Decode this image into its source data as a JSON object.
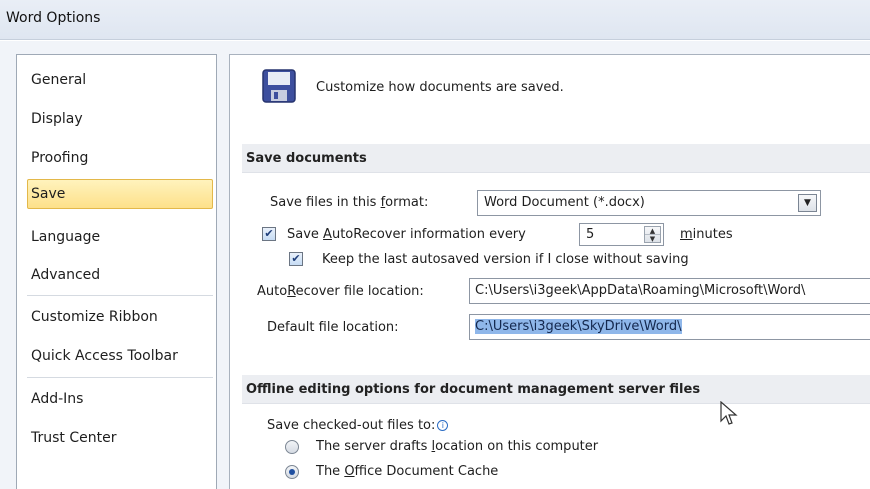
{
  "window": {
    "title": "Word Options"
  },
  "sidebar": {
    "items": [
      {
        "label": "General",
        "selected": false
      },
      {
        "label": "Display",
        "selected": false
      },
      {
        "label": "Proofing",
        "selected": false
      },
      {
        "label": "Save",
        "selected": true
      },
      {
        "label": "Language",
        "selected": false
      },
      {
        "label": "Advanced",
        "selected": false
      },
      {
        "label": "Customize Ribbon",
        "selected": false
      },
      {
        "label": "Quick Access Toolbar",
        "selected": false
      },
      {
        "label": "Add-Ins",
        "selected": false
      },
      {
        "label": "Trust Center",
        "selected": false
      }
    ]
  },
  "header": {
    "icon": "floppy-disk-icon",
    "text": "Customize how documents are saved."
  },
  "save_documents": {
    "section_title": "Save documents",
    "format": {
      "label_pre": "Save files in this ",
      "label_u": "f",
      "label_post": "ormat:",
      "value": "Word Document (*.docx)"
    },
    "autorecover": {
      "checked": true,
      "label_pre": "Save ",
      "label_u": "A",
      "label_post": "utoRecover information every",
      "minutes_value": "5",
      "minutes_u": "m",
      "minutes_post": "inutes"
    },
    "keep_last": {
      "checked": true,
      "label": "Keep the last autosaved version if I close without saving"
    },
    "autorecover_location": {
      "label_pre": "Auto",
      "label_u": "R",
      "label_post": "ecover file location:",
      "value": "C:\\Users\\i3geek\\AppData\\Roaming\\Microsoft\\Word\\"
    },
    "default_location": {
      "label_pre": "Default f",
      "label_u": "i",
      "label_post": "le location:",
      "value": "C:\\Users\\i3geek\\SkyDrive\\Word\\"
    }
  },
  "offline": {
    "section_title": "Offline editing options for document management server files",
    "checked_out_label": "Save checked-out files to:",
    "options": [
      {
        "pre": "The server drafts ",
        "u": "l",
        "post": "ocation on this computer",
        "checked": false
      },
      {
        "pre": "The ",
        "u": "O",
        "post": "ffice Document Cache",
        "checked": true
      }
    ]
  },
  "colors": {
    "selection_highlight": "#fde08a",
    "text_selection": "#8fb7ea",
    "section_bar": "#eceef2",
    "title_bar": "#dfe6f1"
  }
}
